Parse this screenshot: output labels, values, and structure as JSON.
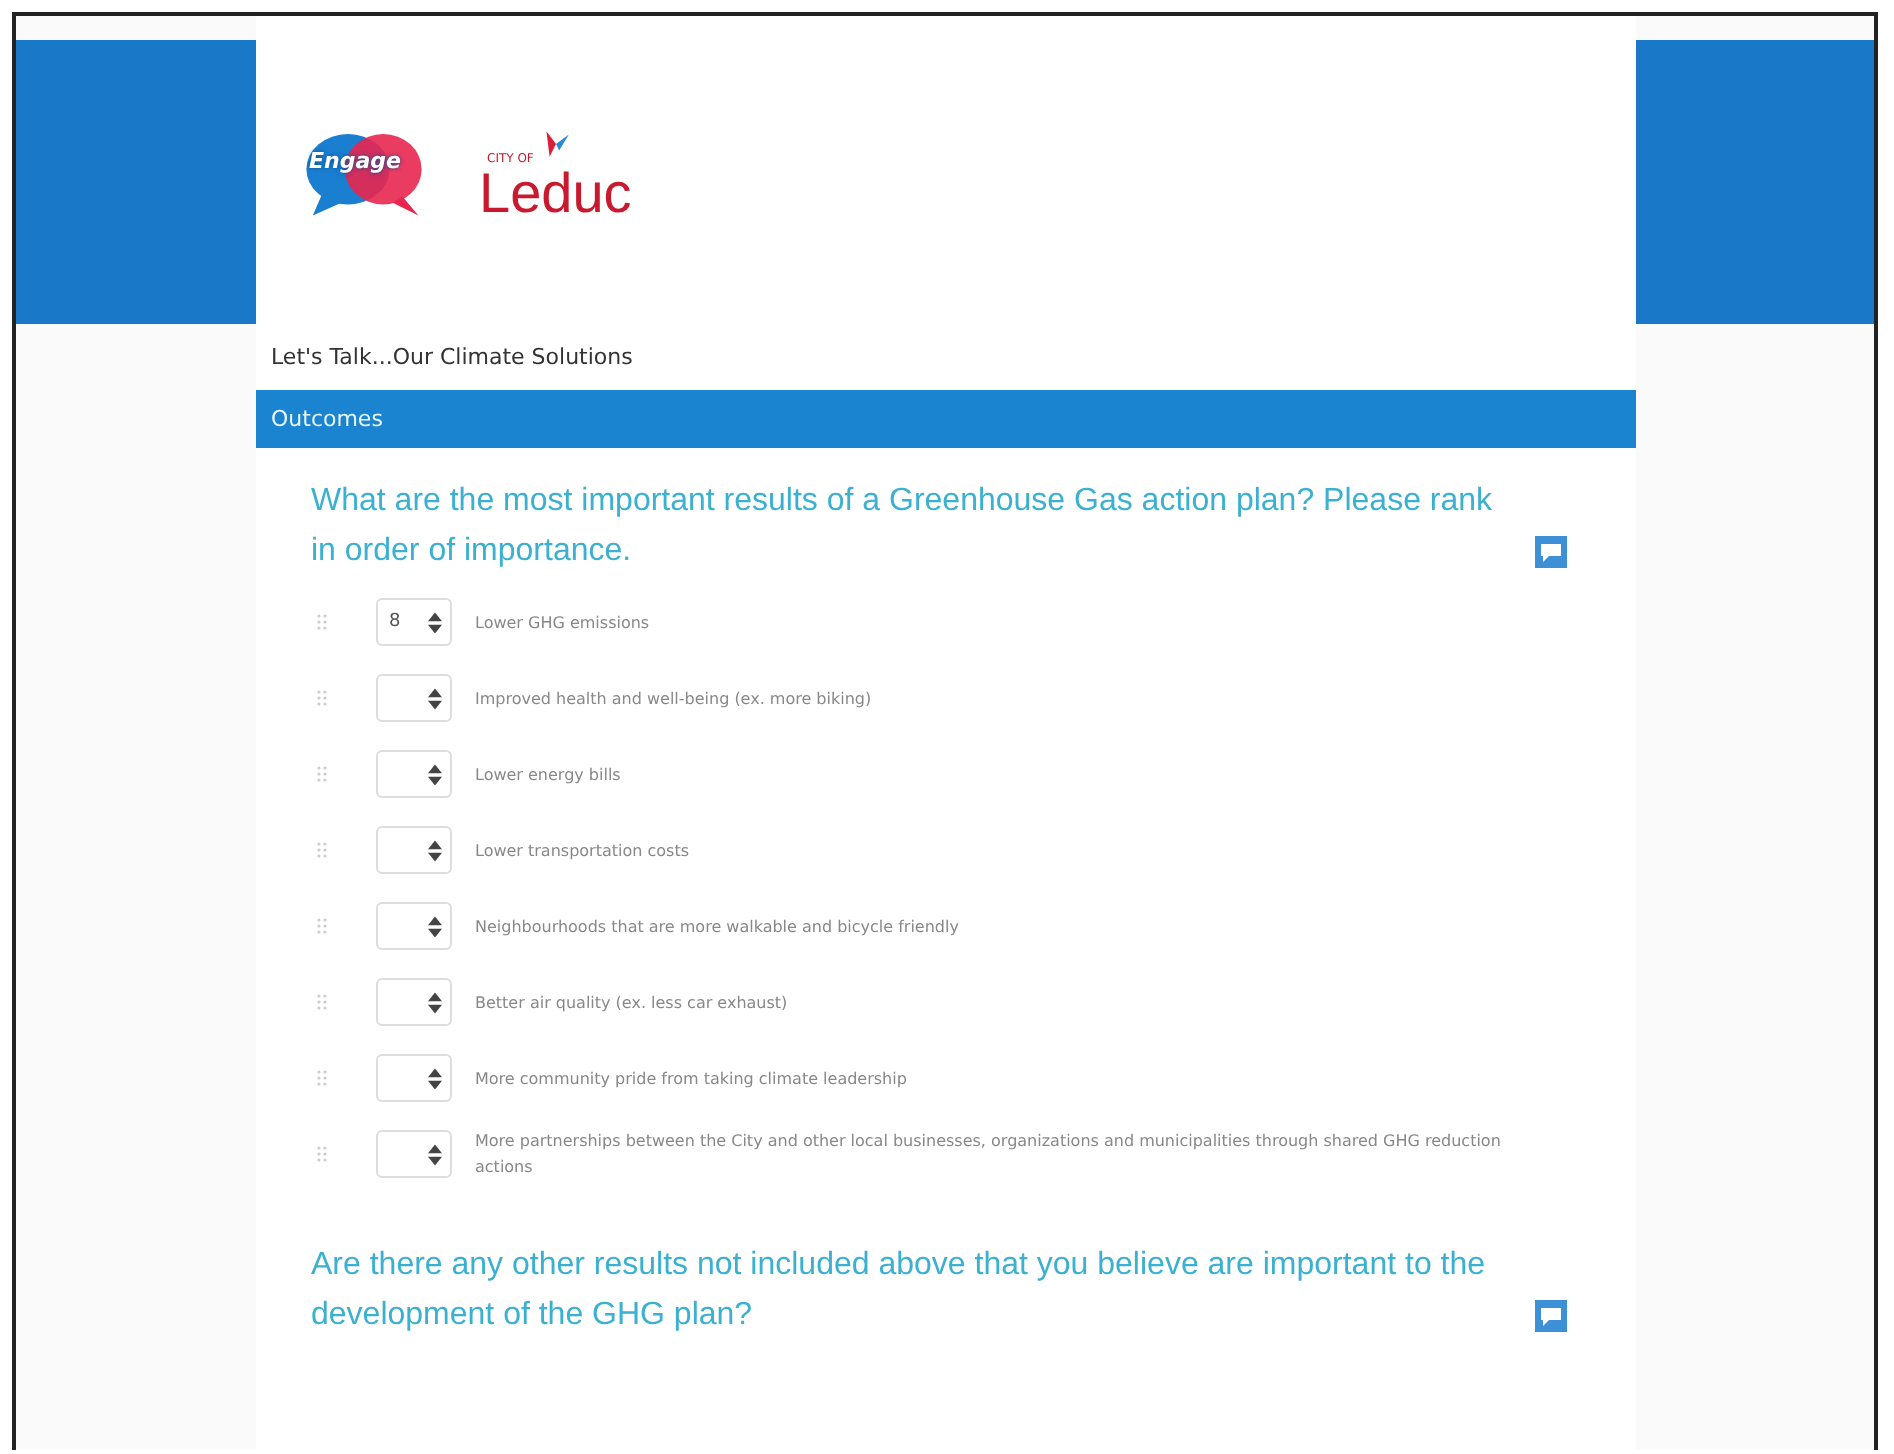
{
  "header": {
    "logo_engage": "Engage",
    "logo_city_small": "CITY OF",
    "logo_city": "Leduc"
  },
  "survey_title": "Let's Talk...Our Climate Solutions",
  "section": "Outcomes",
  "questions": [
    {
      "text": "What are the most important results of a Greenhouse Gas action plan? Please rank in order of importance.",
      "kind": "ranking",
      "items": [
        {
          "value": "8",
          "label": "Lower GHG emissions"
        },
        {
          "label": "Improved health and well-being (ex. more biking)"
        },
        {
          "label": "Lower energy bills"
        },
        {
          "label": "Lower transportation costs"
        },
        {
          "label": "Neighbourhoods that are more walkable and bicycle friendly"
        },
        {
          "label": "Better air quality (ex. less car exhaust)"
        },
        {
          "label": "More community pride from taking climate leadership"
        },
        {
          "label": "More partnerships between the City and other local businesses, organizations and municipalities through shared GHG reduction actions"
        }
      ]
    },
    {
      "text": "Are there any other results not included above that you believe are important to the development of the GHG plan?",
      "kind": "open"
    }
  ]
}
